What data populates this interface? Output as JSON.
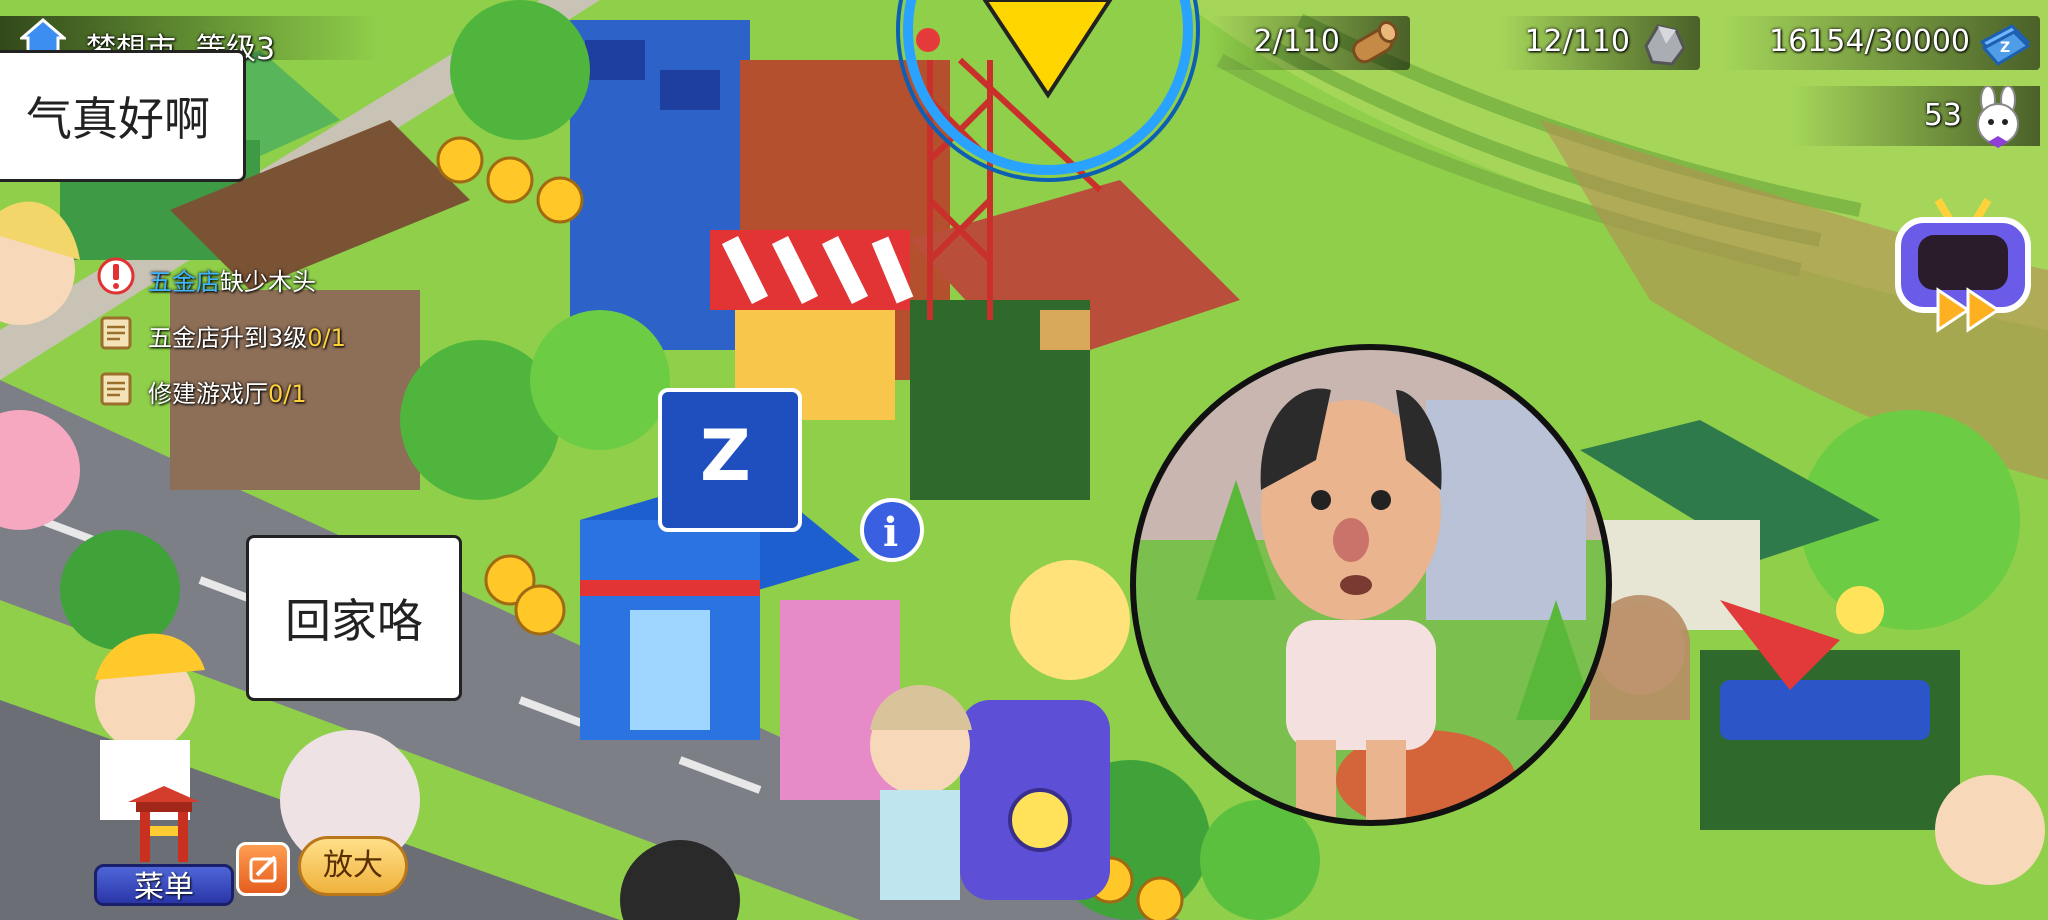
{
  "hud": {
    "city_name": "梦想市",
    "city_level": "等级3",
    "wood": "2/110",
    "stone": "12/110",
    "money": "16154/30000",
    "bunny": "53"
  },
  "bubbles": {
    "weather": "气真好啊",
    "home": "回家咯"
  },
  "quests": [
    {
      "highlight": "五金店",
      "text": "缺少木头",
      "progress": ""
    },
    {
      "highlight": "",
      "text": "五金店升到3级",
      "progress": "0/1"
    },
    {
      "highlight": "",
      "text": "修建游戏厅",
      "progress": "0/1"
    }
  ],
  "buttons": {
    "menu": "菜单",
    "zoom": "放大"
  },
  "colors": {
    "grass": "#8fcf4a",
    "road": "#7d7f86",
    "quest_highlight": "#3fb6ff",
    "quest_progress": "#ffd23a",
    "menu_button": "#3a4ac0",
    "zoom_button": "#f0b23c"
  }
}
